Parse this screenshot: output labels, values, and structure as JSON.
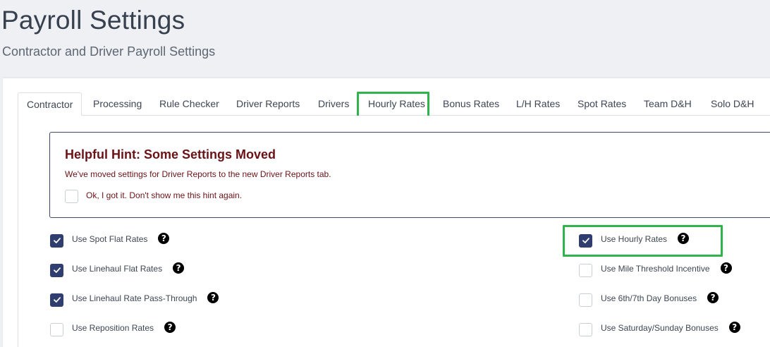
{
  "header": {
    "title": "Payroll Settings",
    "subtitle": "Contractor and Driver Payroll Settings"
  },
  "tabs": [
    {
      "label": "Contractor",
      "active": true
    },
    {
      "label": "Processing"
    },
    {
      "label": "Rule Checker"
    },
    {
      "label": "Driver Reports"
    },
    {
      "label": "Drivers"
    },
    {
      "label": "Hourly Rates",
      "highlighted": true
    },
    {
      "label": "Bonus Rates"
    },
    {
      "label": "L/H Rates"
    },
    {
      "label": "Spot Rates"
    },
    {
      "label": "Team D&H"
    },
    {
      "label": "Solo D&H"
    }
  ],
  "hint": {
    "title": "Helpful Hint: Some Settings Moved",
    "text": "We've moved settings for Driver Reports to the new Driver Reports tab.",
    "dismiss_label": "Ok, I got it. Don't show me this hint again.",
    "dismiss_checked": false
  },
  "options_left": [
    {
      "label": "Use Spot Flat Rates",
      "checked": true
    },
    {
      "label": "Use Linehaul Flat Rates",
      "checked": true
    },
    {
      "label": "Use Linehaul Rate Pass-Through",
      "checked": true
    },
    {
      "label": "Use Reposition Rates",
      "checked": false
    }
  ],
  "options_right": [
    {
      "label": "Use Hourly Rates",
      "checked": true,
      "highlighted": true
    },
    {
      "label": "Use Mile Threshold Incentive",
      "checked": false
    },
    {
      "label": "Use 6th/7th Day Bonuses",
      "checked": false
    },
    {
      "label": "Use Saturday/Sunday Bonuses",
      "checked": false
    }
  ],
  "icons": {
    "help": "question-circle-icon",
    "check": "checkmark-icon"
  },
  "colors": {
    "checkbox_checked": "#2f3e6e",
    "hint_text": "#6b1217",
    "highlight": "#2fb34a"
  }
}
